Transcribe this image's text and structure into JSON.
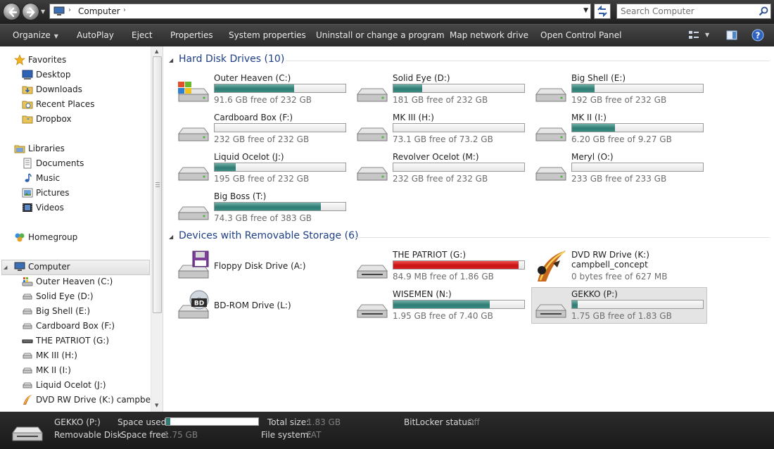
{
  "address": {
    "path": "Computer",
    "search_placeholder": "Search Computer"
  },
  "commands": [
    {
      "label": "Organize",
      "dropdown": true
    },
    {
      "label": "AutoPlay"
    },
    {
      "label": "Eject"
    },
    {
      "label": "Properties"
    },
    {
      "label": "System properties"
    },
    {
      "label": "Uninstall or change a program"
    },
    {
      "label": "Map network drive"
    },
    {
      "label": "Open Control Panel"
    }
  ],
  "nav": {
    "favorites": "Favorites",
    "desktop": "Desktop",
    "downloads": "Downloads",
    "recent": "Recent Places",
    "dropbox": "Dropbox",
    "libraries": "Libraries",
    "documents": "Documents",
    "music": "Music",
    "pictures": "Pictures",
    "videos": "Videos",
    "homegroup": "Homegroup",
    "computer": "Computer",
    "drives": [
      "Outer Heaven (C:)",
      "Solid Eye (D:)",
      "Big Shell (E:)",
      "Cardboard Box (F:)",
      "THE PATRIOT (G:)",
      "MK III (H:)",
      "MK II (I:)",
      "Liquid Ocelot (J:)",
      "DVD RW Drive (K:) campbell_concept"
    ]
  },
  "hdd_group": {
    "title": "Hard Disk Drives (10)",
    "drives": [
      {
        "name": "Outer Heaven (C:)",
        "free": "91.6 GB free of 232 GB",
        "used_fraction": 0.605,
        "icon": "windows-drive-icon"
      },
      {
        "name": "Solid Eye (D:)",
        "free": "181 GB free of 232 GB",
        "used_fraction": 0.22,
        "icon": "hard-drive-icon"
      },
      {
        "name": "Big Shell (E:)",
        "free": "192 GB free of 232 GB",
        "used_fraction": 0.17,
        "icon": "hard-drive-icon"
      },
      {
        "name": "Cardboard Box (F:)",
        "free": "232 GB free of 232 GB",
        "used_fraction": 0.0,
        "icon": "hard-drive-icon"
      },
      {
        "name": "MK III (H:)",
        "free": "73.1 GB free of 73.2 GB",
        "used_fraction": 0.002,
        "icon": "hard-drive-icon"
      },
      {
        "name": "MK II (I:)",
        "free": "6.20 GB free of 9.27 GB",
        "used_fraction": 0.33,
        "icon": "hard-drive-icon"
      },
      {
        "name": "Liquid Ocelot (J:)",
        "free": "195 GB free of 232 GB",
        "used_fraction": 0.16,
        "icon": "hard-drive-icon"
      },
      {
        "name": "Revolver Ocelot (M:)",
        "free": "232 GB free of 232 GB",
        "used_fraction": 0.0,
        "icon": "hard-drive-icon"
      },
      {
        "name": "Meryl (O:)",
        "free": "233 GB free of 233 GB",
        "used_fraction": 0.0,
        "icon": "hard-drive-icon"
      },
      {
        "name": "Big Boss (T:)",
        "free": "74.3 GB free of 383 GB",
        "used_fraction": 0.81,
        "icon": "hard-drive-icon"
      }
    ]
  },
  "removable_group": {
    "title": "Devices with Removable Storage (6)",
    "floppy": {
      "name": "Floppy Disk Drive (A:)"
    },
    "patriot": {
      "name": "THE PATRIOT (G:)",
      "free": "84.9 MB free of 1.86 GB",
      "used_fraction": 0.955,
      "color": "#d01818"
    },
    "dvd": {
      "name": "DVD RW Drive (K:)",
      "label": "campbell_concept",
      "free": "0 bytes free of 627 MB"
    },
    "bdrom": {
      "name": "BD-ROM Drive (L:)",
      "badge": "BD"
    },
    "wisemen": {
      "name": "WISEMEN (N:)",
      "free": "1.95 GB free of 7.40 GB",
      "used_fraction": 0.735
    },
    "gekko": {
      "name": "GEKKO (P:)",
      "free": "1.75 GB free of 1.83 GB",
      "used_fraction": 0.045
    }
  },
  "details": {
    "name": "GEKKO (P:)",
    "type": "Removable Disk",
    "space_used_label": "Space used:",
    "space_free_label": "Space free:",
    "space_free": "1.75 GB",
    "total_size_label": "Total size:",
    "total_size": "1.83 GB",
    "file_system_label": "File system:",
    "file_system": "FAT",
    "bitlocker_label": "BitLocker status:",
    "bitlocker": "Off",
    "used_fraction": 0.045
  },
  "colors": {
    "bar_fill": "#2f7d74",
    "bar_full": "#d01818",
    "group_title": "#1e3e85"
  }
}
